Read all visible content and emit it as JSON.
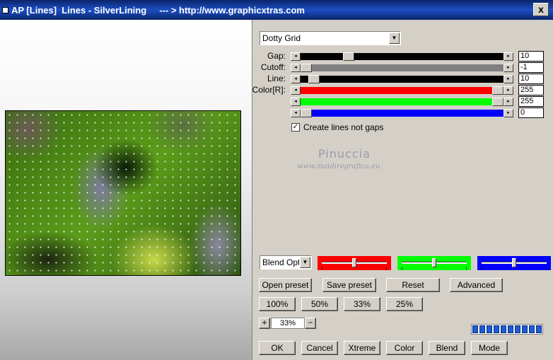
{
  "window": {
    "title": "AP [Lines]  Lines - SilverLining     --- > http://www.graphicxtras.com",
    "close_label": "x"
  },
  "preset_select": {
    "value": "Dotty Grid"
  },
  "sliders": [
    {
      "label": "Gap:",
      "value": "10",
      "level": 0.22,
      "fill": "#000000"
    },
    {
      "label": "Cutoff:",
      "value": "-1",
      "level": 0.0,
      "fill": "#808080"
    },
    {
      "label": "Line:",
      "value": "10",
      "level": 0.04,
      "fill": "#000000"
    },
    {
      "label": "Color[R]:",
      "value": "255",
      "level": 1.0,
      "fill": "#ff0000"
    },
    {
      "label": "",
      "value": "255",
      "level": 1.0,
      "fill": "#00ff00"
    },
    {
      "label": "",
      "value": "0",
      "level": 0.0,
      "fill": "#0000ff"
    }
  ],
  "create_lines": {
    "label": "Create lines not gaps",
    "checked": true,
    "mark": "✓"
  },
  "watermark": {
    "name": "Pinuccia",
    "url": "www.maidiregrafica.eu"
  },
  "blend_select": {
    "value": "Blend Optio"
  },
  "color_bars": [
    {
      "color": "#ff0000",
      "level": 0.5
    },
    {
      "color": "#00ff00",
      "level": 0.5
    },
    {
      "color": "#0000ff",
      "level": 0.5
    }
  ],
  "preset_buttons": {
    "open": "Open preset",
    "save": "Save preset",
    "reset": "Reset",
    "advanced": "Advanced"
  },
  "zoom_buttons": [
    "100%",
    "50%",
    "33%",
    "25%"
  ],
  "zoom": {
    "plus": "+",
    "value": "33%",
    "minus": "−"
  },
  "progress_segments": 10,
  "bottom_buttons": {
    "ok": "OK",
    "cancel": "Cancel",
    "xtreme": "Xtreme",
    "color": "Color",
    "blend": "Blend",
    "mode": "Mode"
  }
}
